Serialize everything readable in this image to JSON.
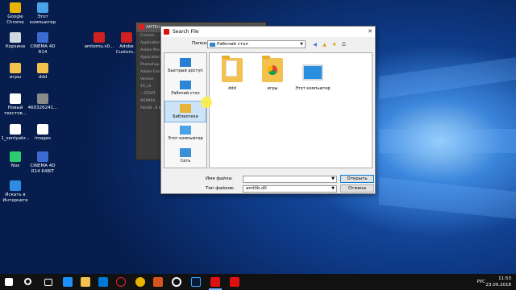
{
  "desktop_icons": [
    {
      "label": "Google Chrome",
      "icon": "chrome-icon",
      "color": "#e8b400"
    },
    {
      "label": "Этот компьютер",
      "icon": "computer-icon",
      "color": "#4aa3e8"
    },
    {
      "label": "Корзина",
      "icon": "recycle-bin-icon",
      "color": "#cfd8e0"
    },
    {
      "label": "CINEMA 4D R14",
      "icon": "cinema4d-icon",
      "color": "#3b6bd1"
    },
    {
      "label": "amtemu.v0...",
      "icon": "amtemu-icon",
      "color": "#d02020"
    },
    {
      "label": "Adobe Custom...",
      "icon": "adobe-icon",
      "color": "#d02020"
    },
    {
      "label": "игры",
      "icon": "folder-icon",
      "color": "#f2c14e"
    },
    {
      "label": "ddd",
      "icon": "folder-icon",
      "color": "#f2c14e"
    },
    {
      "label": "Новый текстов...",
      "icon": "text-file-icon",
      "color": "#ffffff"
    },
    {
      "label": "460326241...",
      "icon": "image-file-icon",
      "color": "#8a8a8a"
    },
    {
      "label": "1_sentyabr...",
      "icon": "file-icon",
      "color": "#ffffff"
    },
    {
      "label": "images",
      "icon": "file-icon",
      "color": "#ffffff"
    },
    {
      "label": "Nox",
      "icon": "nox-icon",
      "color": "#2ecc71"
    },
    {
      "label": "CINEMA 4D R14 64BIT",
      "icon": "cinema4d-icon",
      "color": "#3b6bd1"
    },
    {
      "label": "Искать в Интернете",
      "icon": "ie-icon",
      "color": "#2d8ce3"
    }
  ],
  "back_window": {
    "title": "AMTEm...",
    "lines": [
      "Custom...",
      "Application",
      "Adobe Pho...",
      "Application",
      "Photoshop ...",
      "Adobe Crea...",
      "Version",
      "19_LS",
      "---START",
      "WOW64 ...",
      "PaintB...8 8_Fi..."
    ]
  },
  "dialog": {
    "title": "Search File",
    "look_in_label": "Папка:",
    "look_in_value": "Рабочий стол",
    "places": [
      {
        "label": "Быстрый доступ",
        "icon": "quick-access-icon"
      },
      {
        "label": "Рабочий стол",
        "icon": "desktop-icon"
      },
      {
        "label": "Библиотеки",
        "icon": "libraries-icon"
      },
      {
        "label": "Этот компьютер",
        "icon": "computer-icon"
      },
      {
        "label": "Сеть",
        "icon": "network-icon"
      }
    ],
    "selected_place": "Библиотеки",
    "files": [
      {
        "label": "ddd",
        "icon": "folder-icon"
      },
      {
        "label": "игры",
        "icon": "folder-chrome-icon"
      },
      {
        "label": "Этот компьютер",
        "icon": "computer-icon"
      }
    ],
    "filename_label": "Имя файла:",
    "filename_value": "",
    "filetype_label": "Тип файлов:",
    "filetype_value": "amtlib.dll",
    "open_label": "Открыть",
    "cancel_label": "Отмена"
  },
  "taskbar": {
    "lang": "РУС",
    "time": "11:53",
    "date": "23.09.2018"
  },
  "colors": {
    "accent": "#0078d7",
    "desktop": "#0e3a86"
  }
}
